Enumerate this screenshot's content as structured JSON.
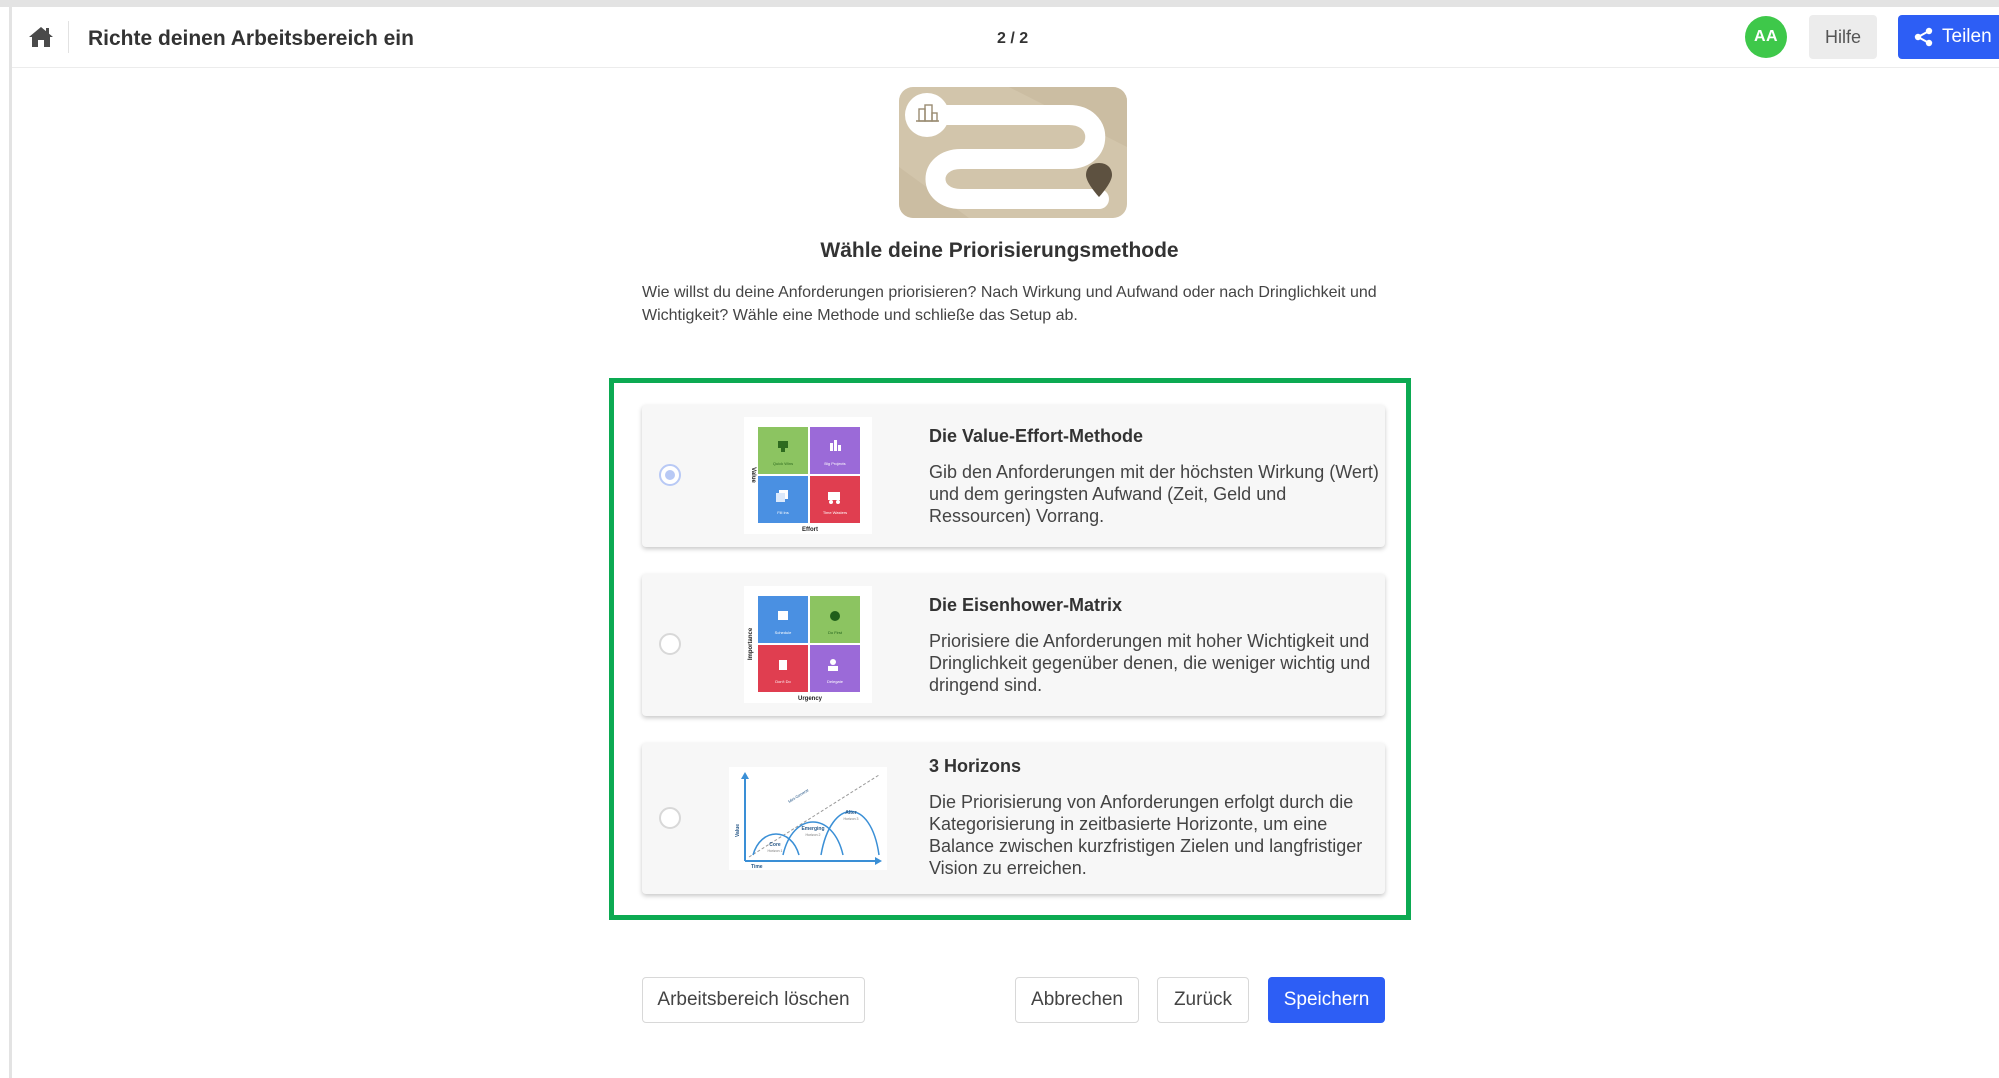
{
  "header": {
    "title": "Richte deinen Arbeitsbereich ein",
    "step": "2 / 2",
    "avatar_initials": "AA",
    "help_label": "Hilfe",
    "share_label": "Teilen"
  },
  "intro": {
    "heading": "Wähle deine Priorisierungsmethode",
    "text": "Wie willst du deine Anforderungen priorisieren? Nach Wirkung und Aufwand oder nach Dringlichkeit und Wichtigkeit? Wähle eine Methode und schließe das Setup ab."
  },
  "options": [
    {
      "title": "Die Value-Effort-Methode",
      "description": "Gib den Anforderungen mit der höchsten Wirkung (Wert) und dem geringsten Aufwand (Zeit, Geld und Ressourcen) Vorrang.",
      "selected": true,
      "thumb": {
        "y_axis": "Value",
        "x_axis": "Effort",
        "quadrants": [
          "Quick Wins",
          "Big Projects",
          "Fill Ins",
          "Time Wasters"
        ]
      }
    },
    {
      "title": "Die Eisenhower-Matrix",
      "description": "Priorisiere die Anforderungen mit hoher Wichtigkeit und Dringlichkeit gegenüber denen, die weniger wichtig und dringend sind.",
      "selected": false,
      "thumb": {
        "y_axis": "Importance",
        "x_axis": "Urgency",
        "quadrants": [
          "Schedule",
          "Do First",
          "Don't Do",
          "Delegate"
        ]
      }
    },
    {
      "title": "3 Horizons",
      "description": "Die Priorisierung von Anforderungen erfolgt durch die Kategorisierung in zeitbasierte Horizonte, um eine Balance zwischen kurzfristigen Zielen und langfristiger Vision zu erreichen.",
      "selected": false,
      "thumb": {
        "y_axis": "Value",
        "x_axis": "Time",
        "labels": [
          "Core",
          "Horizon 1",
          "Emerging",
          "Horizon 2",
          "Alter",
          "Horizon 3",
          "Mini-Generat"
        ]
      }
    }
  ],
  "footer": {
    "delete_label": "Arbeitsbereich löschen",
    "cancel_label": "Abbrechen",
    "back_label": "Zurück",
    "save_label": "Speichern"
  },
  "colors": {
    "primary": "#2d5ef5",
    "highlight": "#0caa52",
    "avatar": "#3ec84a",
    "quadrant_green": "#8cc461",
    "quadrant_purple": "#9b6ad8",
    "quadrant_blue": "#4a90e2",
    "quadrant_red": "#e03e50"
  }
}
